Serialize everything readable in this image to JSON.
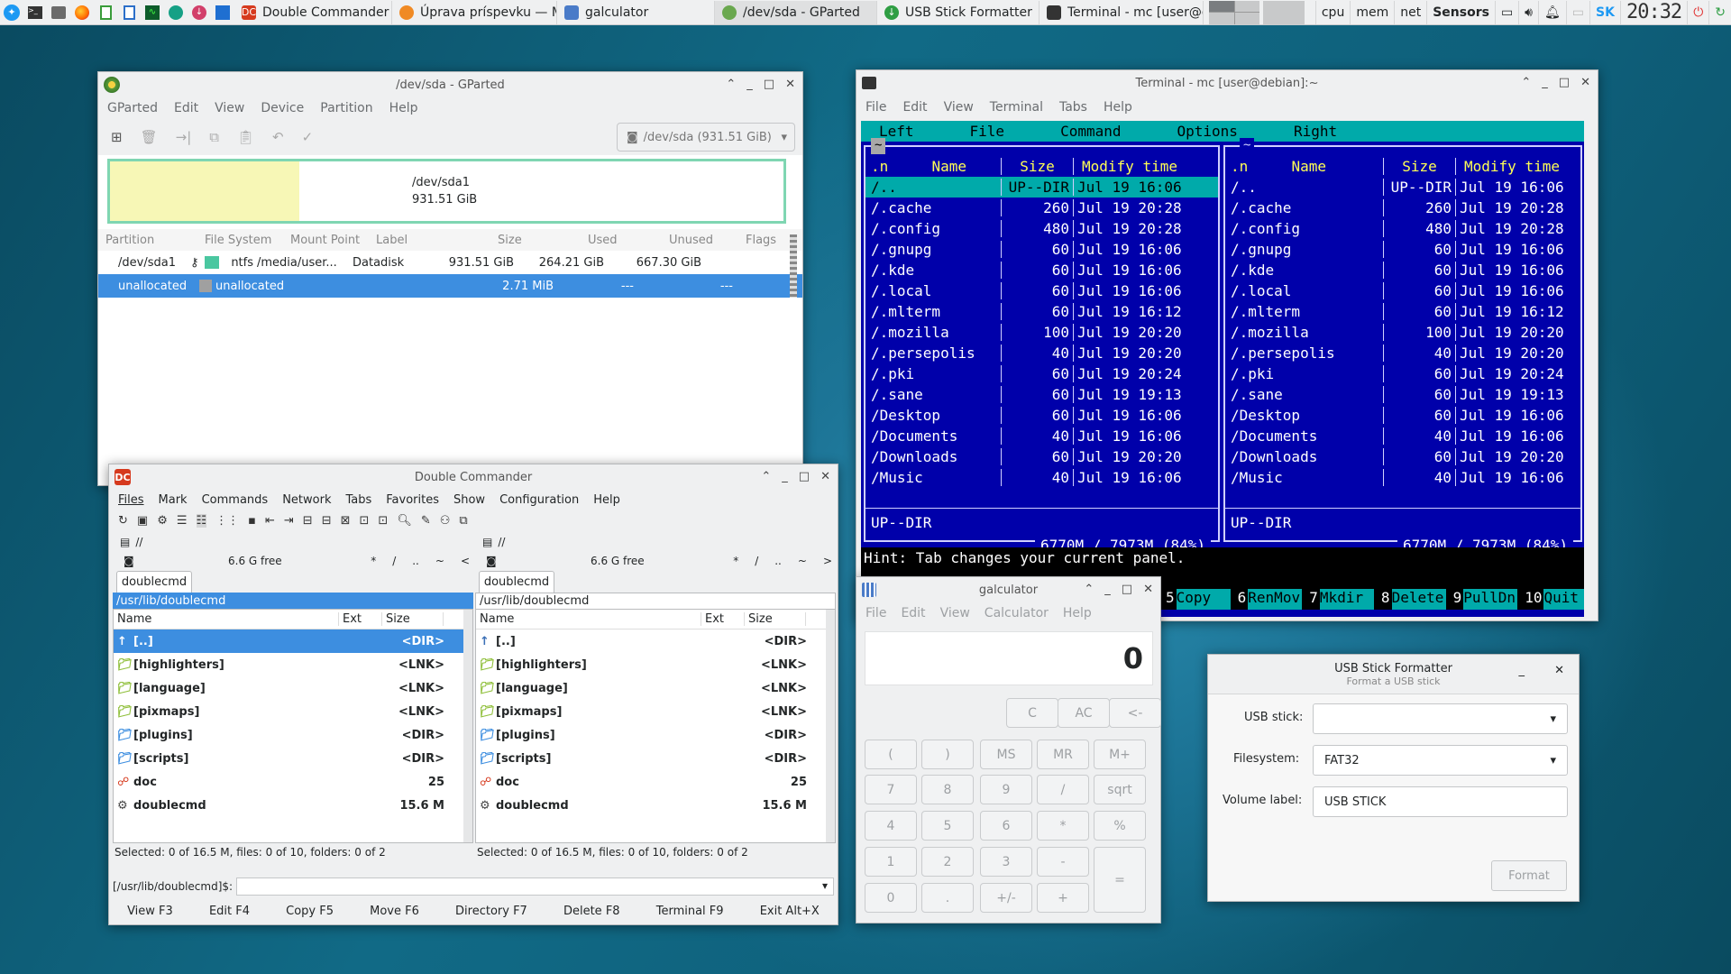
{
  "taskbar": {
    "tasks": [
      {
        "label": "Double Commander",
        "color": "#d63a1e"
      },
      {
        "label": "Úprava príspevku — M...",
        "color": "#f08a24"
      },
      {
        "label": "galculator",
        "color": "#4a7bc8"
      },
      {
        "label": "/dev/sda - GParted",
        "color": "#6aa84f"
      },
      {
        "label": "USB Stick Formatter",
        "color": "#2f9e44"
      },
      {
        "label": "Terminal - mc [user@d...",
        "color": "#333333"
      }
    ],
    "tray": {
      "cpu": "cpu",
      "mem": "mem",
      "net": "net",
      "sensors": "Sensors",
      "layout": "SK",
      "clock": "20:32"
    }
  },
  "gparted": {
    "title": "/dev/sda - GParted",
    "menu": [
      "GParted",
      "Edit",
      "View",
      "Device",
      "Partition",
      "Help"
    ],
    "device_select": "/dev/sda (931.51 GiB)",
    "map": {
      "name": "/dev/sda1",
      "size": "931.51 GiB"
    },
    "columns": [
      "Partition",
      "File System",
      "Mount Point",
      "Label",
      "Size",
      "Used",
      "Unused",
      "Flags"
    ],
    "rows": [
      {
        "partition": "/dev/sda1",
        "fs": "ntfs",
        "mount": "/media/user...",
        "label": "Datadisk",
        "size": "931.51 GiB",
        "used": "264.21 GiB",
        "unused": "667.30 GiB",
        "flags": ""
      },
      {
        "partition": "unallocated",
        "fs": "unallocated",
        "mount": "",
        "label": "",
        "size": "2.71 MiB",
        "used": "---",
        "unused": "---",
        "flags": ""
      }
    ]
  },
  "terminal": {
    "title": "Terminal - mc [user@debian]:~",
    "menu": [
      "File",
      "Edit",
      "View",
      "Terminal",
      "Tabs",
      "Help"
    ],
    "mc_menu": [
      "Left",
      "File",
      "Command",
      "Options",
      "Right"
    ],
    "panel_header": {
      "n": ".n",
      "name": "Name",
      "size": "Size",
      "modify": "Modify time"
    },
    "left_path": "~",
    "right_path": "~",
    "rows": [
      {
        "name": "/..",
        "size": "UP--DIR",
        "time": "Jul 19 16:06"
      },
      {
        "name": "/.cache",
        "size": "260",
        "time": "Jul 19 20:28"
      },
      {
        "name": "/.config",
        "size": "480",
        "time": "Jul 19 20:28"
      },
      {
        "name": "/.gnupg",
        "size": "60",
        "time": "Jul 19 16:06"
      },
      {
        "name": "/.kde",
        "size": "60",
        "time": "Jul 19 16:06"
      },
      {
        "name": "/.local",
        "size": "60",
        "time": "Jul 19 16:06"
      },
      {
        "name": "/.mlterm",
        "size": "60",
        "time": "Jul 19 16:12"
      },
      {
        "name": "/.mozilla",
        "size": "100",
        "time": "Jul 19 20:20"
      },
      {
        "name": "/.persepolis",
        "size": "40",
        "time": "Jul 19 20:20"
      },
      {
        "name": "/.pki",
        "size": "60",
        "time": "Jul 19 20:24"
      },
      {
        "name": "/.sane",
        "size": "60",
        "time": "Jul 19 19:13"
      },
      {
        "name": "/Desktop",
        "size": "60",
        "time": "Jul 19 16:06"
      },
      {
        "name": "/Documents",
        "size": "40",
        "time": "Jul 19 16:06"
      },
      {
        "name": "/Downloads",
        "size": "60",
        "time": "Jul 19 20:20"
      },
      {
        "name": "/Music",
        "size": "40",
        "time": "Jul 19 16:06"
      }
    ],
    "mini_status": "UP--DIR",
    "disk": "6770M / 7973M (84%)",
    "hint": "Hint: Tab changes your current panel.",
    "fkeys": [
      {
        "n": "5",
        "label": "Copy"
      },
      {
        "n": "6",
        "label": "RenMov"
      },
      {
        "n": "7",
        "label": "Mkdir"
      },
      {
        "n": "8",
        "label": "Delete"
      },
      {
        "n": "9",
        "label": "PullDn"
      },
      {
        "n": "10",
        "label": "Quit"
      }
    ]
  },
  "dc": {
    "title": "Double Commander",
    "menu": [
      "Files",
      "Mark",
      "Commands",
      "Network",
      "Tabs",
      "Favorites",
      "Show",
      "Configuration",
      "Help"
    ],
    "drive": "//",
    "free": "6.6 G free",
    "nav": [
      "*",
      "/",
      "..",
      "~",
      "<"
    ],
    "nav_right": [
      "*",
      "/",
      "..",
      "~",
      ">"
    ],
    "tab": "doublecmd",
    "path": "/usr/lib/doublecmd",
    "columns": [
      "Name",
      "Ext",
      "Size"
    ],
    "files": [
      {
        "name": "[..]",
        "size": "<DIR>"
      },
      {
        "name": "[highlighters]",
        "size": "<LNK>"
      },
      {
        "name": "[language]",
        "size": "<LNK>"
      },
      {
        "name": "[pixmaps]",
        "size": "<LNK>"
      },
      {
        "name": "[plugins]",
        "size": "<DIR>"
      },
      {
        "name": "[scripts]",
        "size": "<DIR>"
      },
      {
        "name": "doc",
        "size": "25"
      },
      {
        "name": "doublecmd",
        "size": "15.6 M"
      }
    ],
    "status": "Selected: 0 of 16.5 M, files: 0 of 10, folders: 0 of 2",
    "cmd_prompt": "[/usr/lib/doublecmd]$:",
    "fbuttons": [
      "View F3",
      "Edit F4",
      "Copy F5",
      "Move F6",
      "Directory F7",
      "Delete F8",
      "Terminal F9",
      "Exit Alt+X"
    ]
  },
  "calc": {
    "title": "galculator",
    "menu": [
      "File",
      "Edit",
      "View",
      "Calculator",
      "Help"
    ],
    "display": "0",
    "row0": [
      "C",
      "AC",
      "<-"
    ],
    "row1": [
      "(",
      ")",
      "MS",
      "MR",
      "M+"
    ],
    "rows": [
      [
        "7",
        "8",
        "9",
        "/",
        "sqrt"
      ],
      [
        "4",
        "5",
        "6",
        "*",
        "%"
      ],
      [
        "1",
        "2",
        "3",
        "-"
      ],
      [
        "0",
        ".",
        "+/-",
        "+"
      ]
    ],
    "eq": "="
  },
  "usb": {
    "title": "USB Stick Formatter",
    "subtitle": "Format a USB stick",
    "stick_label": "USB stick:",
    "stick_value": "",
    "fs_label": "Filesystem:",
    "fs_value": "FAT32",
    "vol_label": "Volume label:",
    "vol_value": "USB STICK",
    "format_button": "Format"
  }
}
